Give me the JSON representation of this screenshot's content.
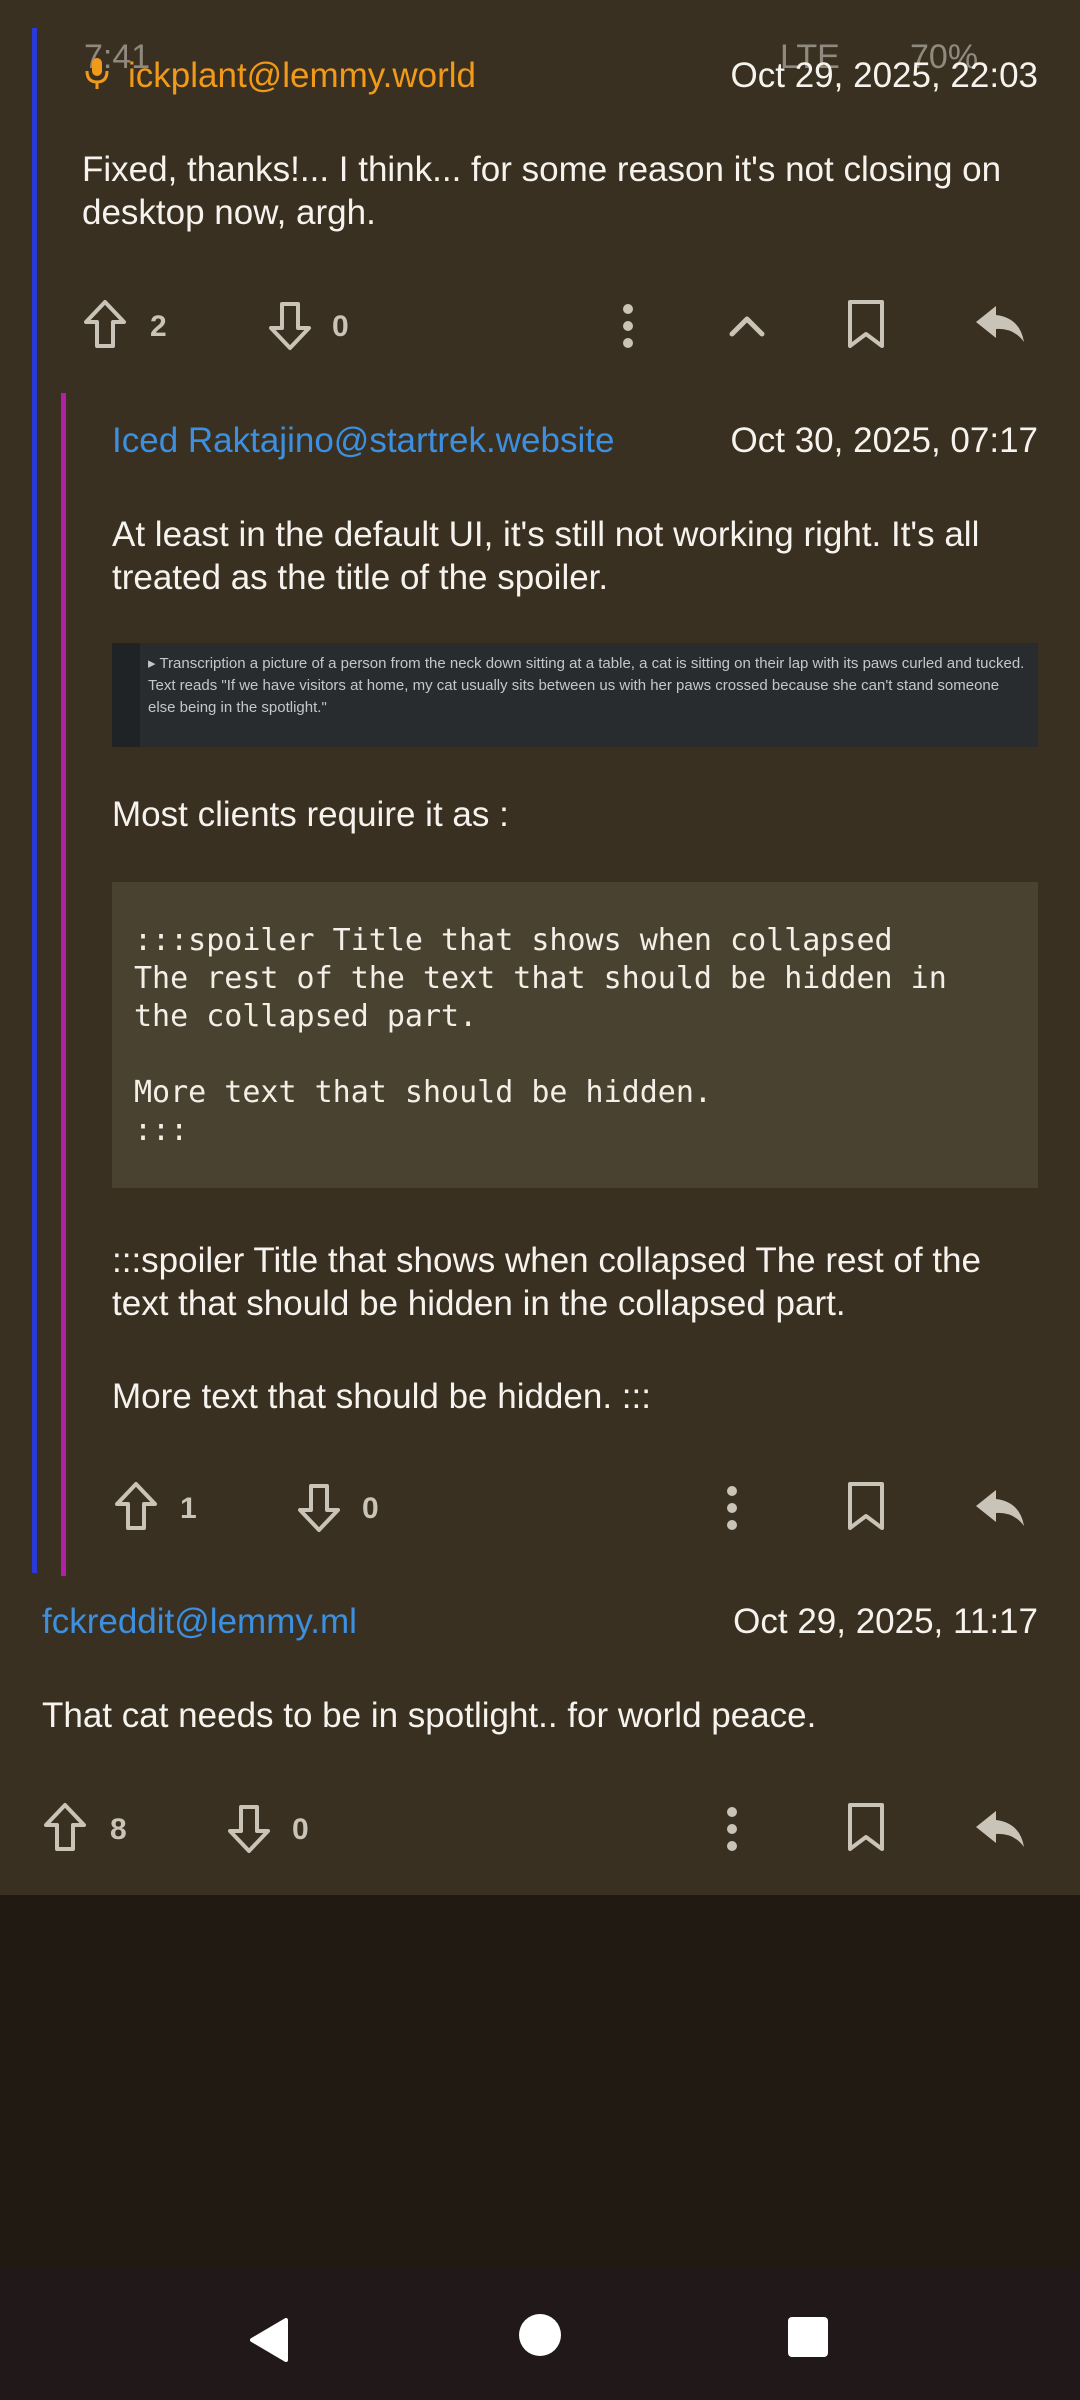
{
  "status_bar": {
    "time": "7:41",
    "network": "LTE",
    "battery": "70%"
  },
  "comments": [
    {
      "author": "ickplant@lemmy.world",
      "timestamp": "Oct 29, 2025, 22:03",
      "body": "Fixed, thanks!... I think... for some reason it's not closing on desktop now, argh.",
      "upvotes": "2",
      "downvotes": "0"
    },
    {
      "author": "Iced Raktajino@startrek.website",
      "timestamp": "Oct 30, 2025, 07:17",
      "body_intro": "At least in the default UI, it's still not working right.  It's all treated as the title of the spoiler.",
      "image_text": "Transcription a picture of a person from the neck down sitting at a table, a cat is sitting on their lap with its paws curled and tucked. Text reads \"If we have visitors at home, my cat usually sits between us with her paws crossed because she can't stand someone else being in the spotlight.\"",
      "body_mid": "Most clients require it as :",
      "code": ":::spoiler Title that shows when collapsed\nThe rest of the text that should be hidden in\nthe collapsed part.\n\nMore text that should be hidden.\n:::",
      "body_rendered_1": ":::spoiler Title that shows when collapsed The rest of the text that should be hidden in the collapsed part.",
      "body_rendered_2": "More text that should be hidden. :::",
      "upvotes": "1",
      "downvotes": "0"
    },
    {
      "author": "fckreddit@lemmy.ml",
      "timestamp": "Oct 29, 2025, 11:17",
      "body": "That cat needs to be in spotlight.. for world peace.",
      "upvotes": "8",
      "downvotes": "0"
    }
  ],
  "colors": {
    "background": "#393021",
    "thread_level_1": "#2a3ad8",
    "thread_level_2": "#b21fa8",
    "author_link": "#3d8fe0",
    "op_author": "#f19a1a"
  },
  "icons": [
    "microphone-icon",
    "upvote-icon",
    "downvote-icon",
    "more-icon",
    "collapse-icon",
    "bookmark-icon",
    "reply-icon",
    "back-icon",
    "home-icon",
    "recents-icon"
  ]
}
